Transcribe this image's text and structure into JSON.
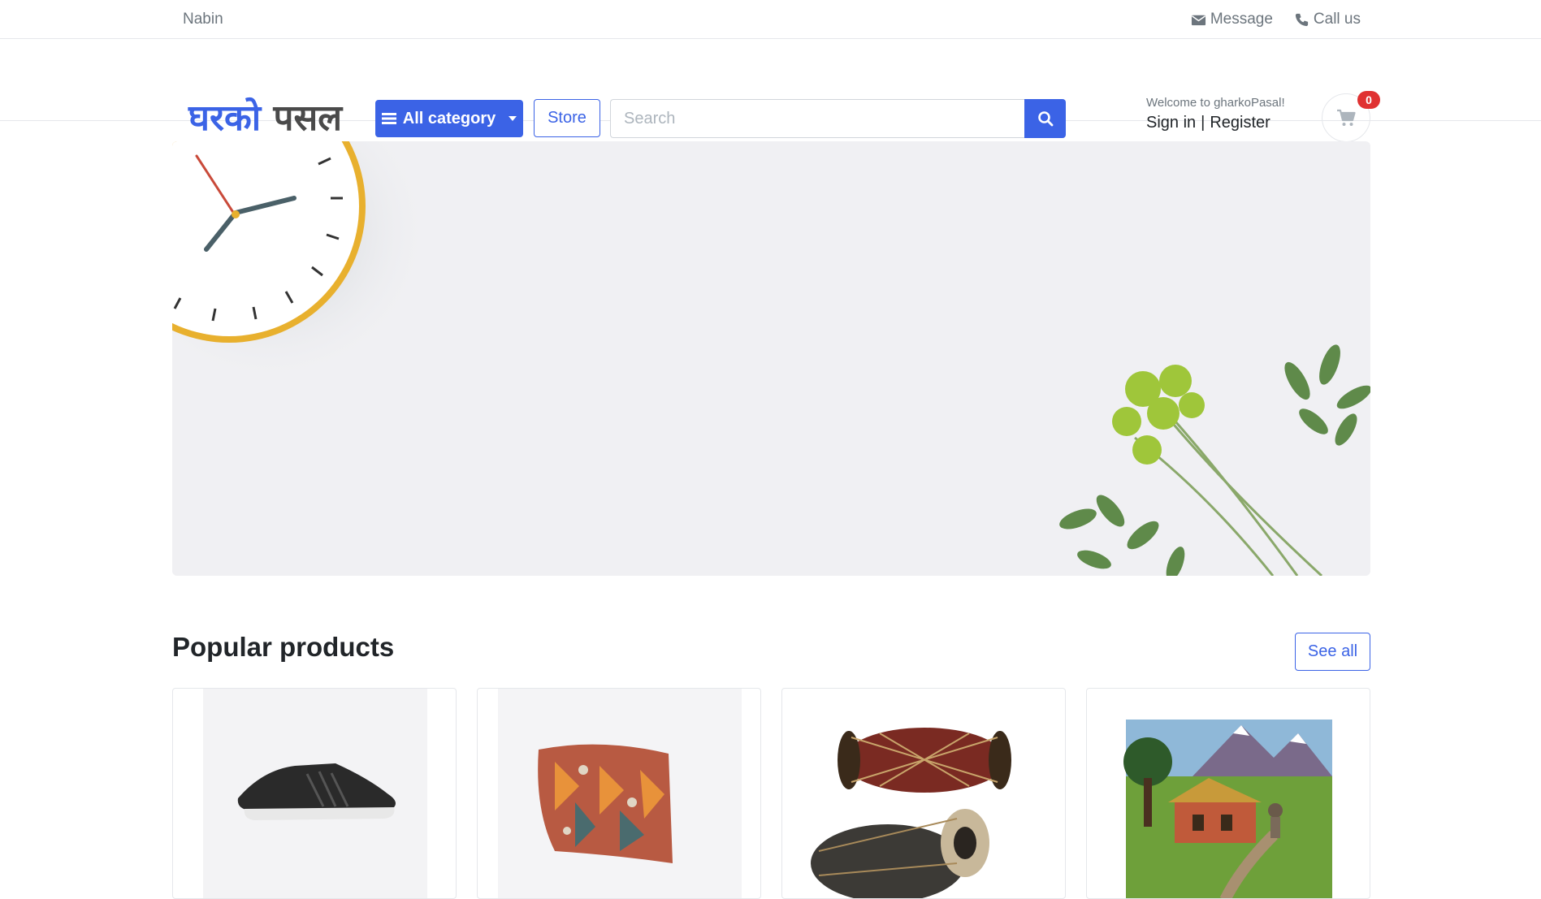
{
  "topbar": {
    "username": "Nabin",
    "message_label": "Message",
    "call_label": "Call us"
  },
  "header": {
    "logo_part1": "घरको",
    "logo_part2": "पसल",
    "category_label": "All category",
    "store_label": "Store",
    "search_placeholder": "Search",
    "welcome_text": "Welcome to gharkoPasal!",
    "signin_label": "Sign in",
    "separator": "|",
    "register_label": "Register",
    "cart_count": "0"
  },
  "popular": {
    "title": "Popular products",
    "see_all_label": "See all",
    "products": [
      {
        "icon": "sneaker-image"
      },
      {
        "icon": "woven-bag-image"
      },
      {
        "icon": "madal-drum-image"
      },
      {
        "icon": "village-painting-image"
      }
    ]
  },
  "colors": {
    "primary": "#3b63e6",
    "badge": "#e03131",
    "banner_bg": "#f0f0f3"
  }
}
